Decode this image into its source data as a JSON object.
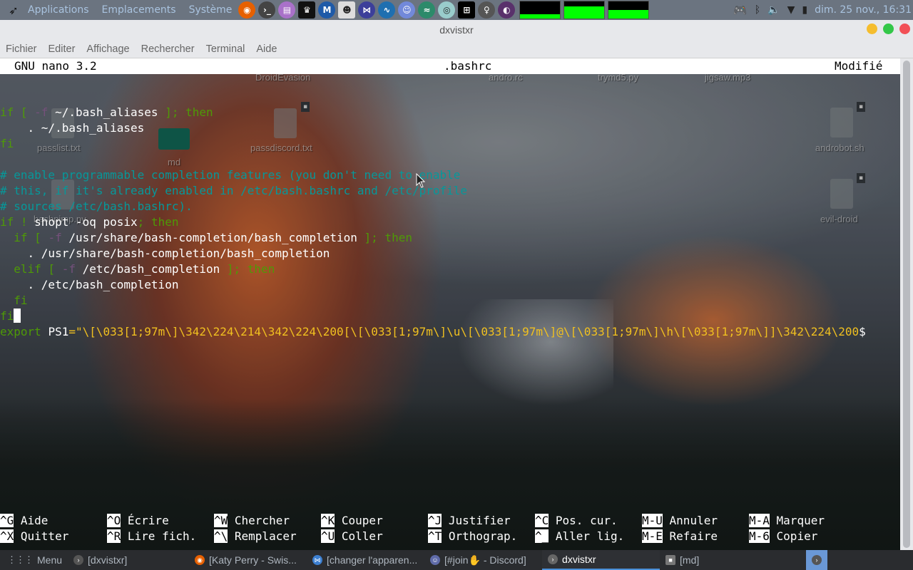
{
  "top_panel": {
    "menus": [
      "Applications",
      "Emplacements",
      "Système"
    ],
    "launchers": [
      {
        "name": "firefox-icon",
        "color": "#e66000"
      },
      {
        "name": "terminal-icon",
        "color": "#444"
      },
      {
        "name": "text-editor-icon",
        "color": "#a971c9"
      },
      {
        "name": "kali-tool-icon",
        "color": "#111"
      },
      {
        "name": "metasploit-icon",
        "color": "#1e5aa8"
      },
      {
        "name": "mask-app-icon",
        "color": "#ddd"
      },
      {
        "name": "vscode-icon",
        "color": "#3c3f9a"
      },
      {
        "name": "wireshark-icon",
        "color": "#1f6fb0"
      },
      {
        "name": "discord-icon",
        "color": "#7289da"
      },
      {
        "name": "dragon-app-icon",
        "color": "#2c8a6a"
      },
      {
        "name": "eye-app-icon",
        "color": "#9cc"
      },
      {
        "name": "network-app-icon",
        "color": "#000"
      },
      {
        "name": "bulb-icon",
        "color": "#555"
      },
      {
        "name": "tor-icon",
        "color": "#59316b"
      }
    ],
    "monitors": [
      {
        "name": "cpu-monitor",
        "level": 0.25
      },
      {
        "name": "memory-monitor",
        "level": 0.7
      },
      {
        "name": "network-monitor",
        "level": 0.5
      }
    ],
    "tray": {
      "clock": "dim. 25 nov., 16:31"
    }
  },
  "window": {
    "title": "dxvistxr",
    "menu": [
      "Fichier",
      "Editer",
      "Affichage",
      "Rechercher",
      "Terminal",
      "Aide"
    ],
    "buttons": {
      "minimize": "#f5bd2e",
      "maximize": "#33c748",
      "close": "#f25056"
    }
  },
  "nano": {
    "version": "GNU nano 3.2",
    "filename": ".bashrc",
    "status": "Modifié",
    "lines": [
      [
        {
          "t": "if [ ",
          "c": "kw"
        },
        {
          "t": "-f",
          "c": "opt"
        },
        {
          "t": " ~/.bash_aliases ",
          "c": ""
        },
        {
          "t": "]; then",
          "c": "kw"
        }
      ],
      [
        {
          "t": "    . ~/.bash_aliases",
          "c": ""
        }
      ],
      [
        {
          "t": "fi",
          "c": "kw"
        }
      ],
      [],
      [
        {
          "t": "# enable programmable completion features (you don't need to enable",
          "c": "cmt"
        }
      ],
      [
        {
          "t": "# this, if it's already enabled in /etc/bash.bashrc and /etc/profile",
          "c": "cmt"
        }
      ],
      [
        {
          "t": "# sources /etc/bash.bashrc).",
          "c": "cmt"
        }
      ],
      [
        {
          "t": "if ! ",
          "c": "kw"
        },
        {
          "t": "shopt -oq posix",
          "c": ""
        },
        {
          "t": "; then",
          "c": "kw"
        }
      ],
      [
        {
          "t": "  if [ ",
          "c": "kw"
        },
        {
          "t": "-f",
          "c": "opt"
        },
        {
          "t": " /usr/share/bash-completion/bash_completion ",
          "c": ""
        },
        {
          "t": "]; then",
          "c": "kw"
        }
      ],
      [
        {
          "t": "    . /usr/share/bash-completion/bash_completion",
          "c": ""
        }
      ],
      [
        {
          "t": "  elif [ ",
          "c": "kw"
        },
        {
          "t": "-f",
          "c": "opt"
        },
        {
          "t": " /etc/bash_completion ",
          "c": ""
        },
        {
          "t": "]; then",
          "c": "kw"
        }
      ],
      [
        {
          "t": "    . /etc/bash_completion",
          "c": ""
        }
      ],
      [
        {
          "t": "  fi",
          "c": "kw"
        }
      ],
      [
        {
          "t": "fi",
          "c": "kw"
        },
        {
          "t": "",
          "c": "cursor"
        }
      ],
      [
        {
          "t": "export ",
          "c": "kw"
        },
        {
          "t": "PS1",
          "c": ""
        },
        {
          "t": "=\"\\[\\033[1;97m\\]\\342\\224\\214\\342\\224\\200[\\[\\033[1;97m\\]\\u\\[\\033[1;97m\\]@\\[\\033[1;97m\\]\\h\\[\\033[1;97m\\]]\\342\\224\\200",
          "c": "str"
        },
        {
          "t": "$",
          "c": ""
        }
      ]
    ],
    "shortcuts": [
      [
        {
          "key": "^G",
          "label": "Aide"
        },
        {
          "key": "^X",
          "label": "Quitter"
        }
      ],
      [
        {
          "key": "^O",
          "label": "Écrire"
        },
        {
          "key": "^R",
          "label": "Lire fich."
        }
      ],
      [
        {
          "key": "^W",
          "label": "Chercher"
        },
        {
          "key": "^\\",
          "label": "Remplacer"
        }
      ],
      [
        {
          "key": "^K",
          "label": "Couper"
        },
        {
          "key": "^U",
          "label": "Coller"
        }
      ],
      [
        {
          "key": "^J",
          "label": "Justifier"
        },
        {
          "key": "^T",
          "label": "Orthograp."
        }
      ],
      [
        {
          "key": "^C",
          "label": "Pos. cur."
        },
        {
          "key": "^_",
          "label": "Aller lig."
        }
      ],
      [
        {
          "key": "M-U",
          "label": "Annuler"
        },
        {
          "key": "M-E",
          "label": "Refaire"
        }
      ],
      [
        {
          "key": "M-A",
          "label": "Marquer"
        },
        {
          "key": "M-6",
          "label": "Copier"
        }
      ]
    ]
  },
  "desktop_icons": {
    "droidevasion": "DroidEvasion",
    "andro_rc": "andro.rc",
    "trymd5": "trymd5.py",
    "jigsaw": "jigsaw.mp3",
    "passlist": "passlist.txt",
    "md": "md",
    "passdiscord": "passdiscord.txt",
    "androbot": "androbot.sh",
    "bashpimp": "bashpimp.py",
    "evil_droid": "evil-droid"
  },
  "taskbar": {
    "menu_label": "Menu",
    "tasks": [
      {
        "label": "[dxvistxr]",
        "icon": "terminal-icon",
        "color": "#555"
      },
      {
        "label": "[Katy Perry - Swis...",
        "icon": "firefox-icon",
        "color": "#e66000"
      },
      {
        "label": "[changer l'apparen...",
        "icon": "vscode-icon",
        "color": "#3c7fd0"
      },
      {
        "label": "[#join✋ - Discord]",
        "icon": "discord-icon",
        "color": "#5f6ba8"
      },
      {
        "label": "dxvistxr",
        "icon": "terminal-icon",
        "color": "#666"
      },
      {
        "label": "[md]",
        "icon": "folder-icon",
        "color": "#777"
      }
    ]
  }
}
